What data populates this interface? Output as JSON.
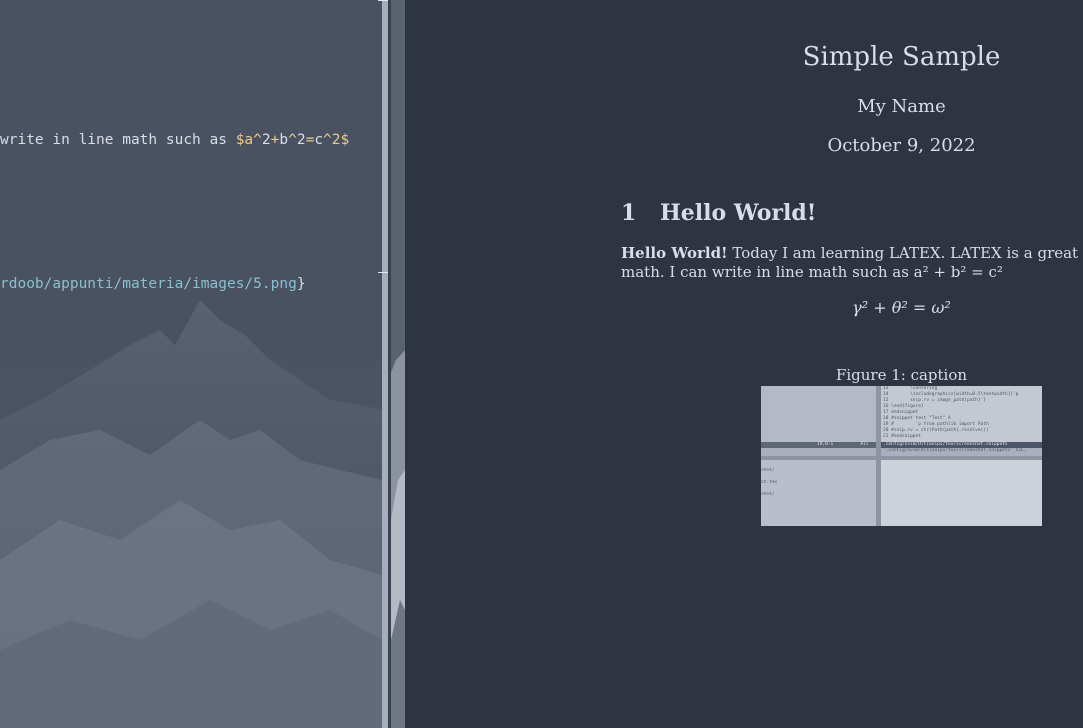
{
  "editor": {
    "lines": [
      {
        "parts": [
          {
            "text": "write in line math such as ",
            "color": "#d8dee9"
          },
          {
            "text": "$a",
            "color": "#ebcb8b"
          },
          {
            "text": "^",
            "color": "#ebcb8b"
          },
          {
            "text": "2",
            "color": "#d8dee9"
          },
          {
            "text": "+",
            "color": "#ebcb8b"
          },
          {
            "text": "b",
            "color": "#d8dee9"
          },
          {
            "text": "^",
            "color": "#ebcb8b"
          },
          {
            "text": "2",
            "color": "#d8dee9"
          },
          {
            "text": "=",
            "color": "#ebcb8b"
          },
          {
            "text": "c",
            "color": "#d8dee9"
          },
          {
            "text": "^",
            "color": "#ebcb8b"
          },
          {
            "text": "2$",
            "color": "#ebcb8b"
          }
        ]
      },
      {
        "parts": [
          {
            "text": "rdoob/appunti/materia/images/5.png",
            "color": "#88c0d0"
          },
          {
            "text": "}",
            "color": "#d8dee9"
          }
        ]
      }
    ]
  },
  "document": {
    "title": "Simple Sample",
    "author": "My Name",
    "date": "October 9, 2022",
    "section": {
      "number": "1",
      "title": "Hello World!"
    },
    "paragraph": {
      "bold_lead": "Hello World!",
      "line1_rest": " Today I am learning LATEX. LATEX is a great progr",
      "line2": "math. I can write in line math such as a² + b² = c²"
    },
    "equation": "γ² + θ² = ω²",
    "figure_caption": "Figure 1: caption",
    "figure_image": {
      "code_lines": [
        "13        \\centering",
        "14        \\includegraphics[width=0.5\\textwidth]{'p",
        "15        snip.rv = image_path(path)'}",
        "16 \\end{figure}",
        "17 endsnippet",
        "18 #snippet test \"Test\" A",
        "19 #        `p from pathlib import Path",
        "20 #snip.rv = str(Path(path).resolve())`",
        "21 #endsnippet"
      ],
      "status_left": "19,0-1          All",
      "status_right": ".config/nvim/UltiSnips/tex/screenshot.snippets",
      "status_right2": "'.config/nvim/UltiSnips/tex/screenshot.snippets' 41L,",
      "left_lines": [
        "shot/",
        "st.tex",
        "shot/"
      ]
    }
  }
}
